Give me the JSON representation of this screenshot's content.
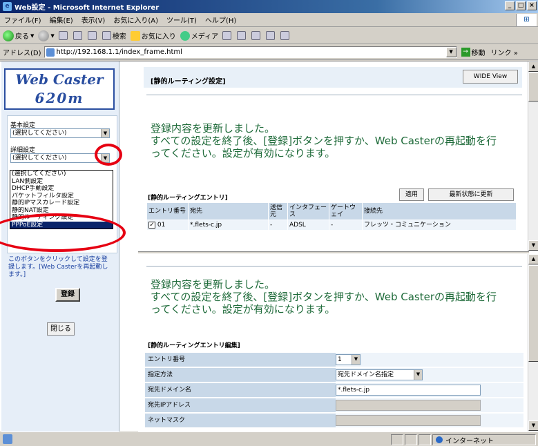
{
  "window": {
    "title": "Web設定 - Microsoft Internet Explorer",
    "buttons": [
      "_",
      "□",
      "×"
    ]
  },
  "menubar": {
    "items": [
      "ファイル(F)",
      "編集(E)",
      "表示(V)",
      "お気に入り(A)",
      "ツール(T)",
      "ヘルプ(H)"
    ]
  },
  "toolbar": {
    "back_label": "戻る",
    "search_label": "検索",
    "favorites_label": "お気に入り",
    "media_label": "メディア"
  },
  "address": {
    "label": "アドレス(D)",
    "url": "http://192.168.1.1/index_frame.html",
    "go_label": "移動",
    "links_label": "リンク »"
  },
  "left": {
    "logo_line1": "Web Caster",
    "logo_line2": "620m",
    "basic_label": "基本設定",
    "basic_select": "(選択してください)",
    "detail_label": "詳細設定",
    "detail_select": "(選択してください)",
    "dropdown_options": [
      "(選択してください)",
      "LAN側設定",
      "DHCP手動設定",
      "パケットフィルタ設定",
      "静的IPマスカレード設定",
      "静的NAT設定",
      "静的ルーティング設定",
      "PPPoE設定"
    ],
    "help_text": "このボタンをクリックして設定を登録します。[Web Casterを再起動します。]",
    "register_label": "登録",
    "close_label": "閉じる"
  },
  "top_frame": {
    "section_title": "[静的ルーティング設定]",
    "wide_view_label": "WIDE View",
    "message_line1": "登録内容を更新しました。",
    "message_line2": "すべての設定を終了後、[登録]ボタンを押すか、Web Casterの再起動を行",
    "message_line3": "ってください。設定が有効になります。",
    "entries_title": "[静的ルーティングエントリ]",
    "apply_label": "適用",
    "refresh_label": "最新状態に更新",
    "table_headers": [
      "エントリ番号",
      "宛先",
      "送信元",
      "インタフェース",
      "ゲートウェイ",
      "接続先"
    ],
    "table_rows": [
      {
        "checked": true,
        "num": "01",
        "dest": "*.flets-c.jp",
        "src": "-",
        "iface": "ADSL",
        "gw": "-",
        "conn": "フレッツ・コミュニケーション"
      }
    ]
  },
  "bottom_frame": {
    "message_line1": "登録内容を更新しました。",
    "message_line2": "すべての設定を終了後、[登録]ボタンを押すか、Web Casterの再起動を行",
    "message_line3": "ってください。設定が有効になります。",
    "edit_title": "[静的ルーティングエントリ編集]",
    "fields": [
      {
        "label": "エントリ番号",
        "value": "1"
      },
      {
        "label": "指定方法",
        "value": "宛先ドメイン名指定"
      },
      {
        "label": "宛先ドメイン名",
        "value": "*.flets-c.jp"
      },
      {
        "label": "宛先IPアドレス",
        "value": ""
      },
      {
        "label": "ネットマスク",
        "value": ""
      }
    ]
  },
  "status": {
    "zone_label": "インターネット"
  }
}
